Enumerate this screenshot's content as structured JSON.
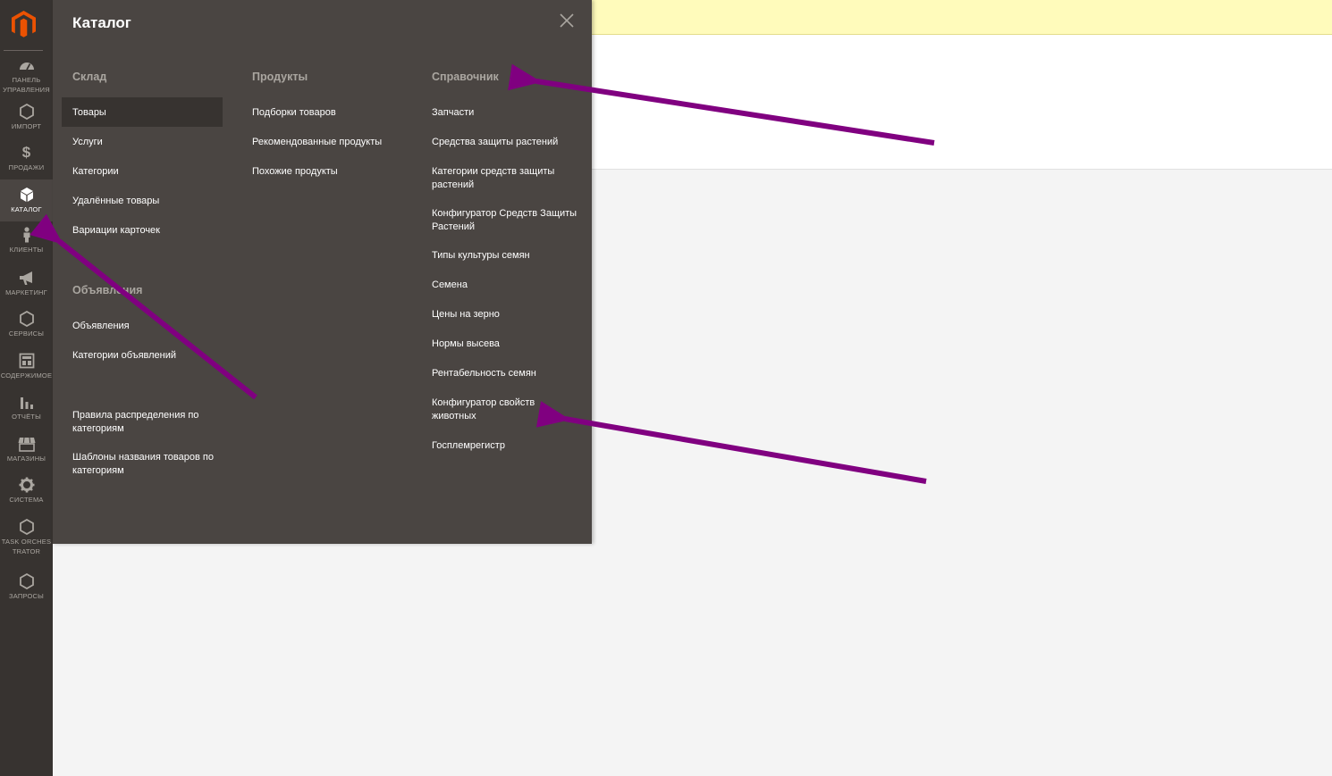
{
  "nav": {
    "items": [
      {
        "label": "ПАНЕЛЬ УПРАВЛЕНИЯ",
        "icon": "dashboard-icon"
      },
      {
        "label": "ИМПОРТ",
        "icon": "hexagon-icon"
      },
      {
        "label": "ПРОДАЖИ",
        "icon": "dollar-icon"
      },
      {
        "label": "КАТАЛОГ",
        "icon": "box-icon"
      },
      {
        "label": "КЛИЕНТЫ",
        "icon": "person-icon"
      },
      {
        "label": "МАРКЕТИНГ",
        "icon": "megaphone-icon"
      },
      {
        "label": "СЕРВИСЫ",
        "icon": "hexagon-icon"
      },
      {
        "label": "СОДЕРЖИМОЕ",
        "icon": "layout-icon"
      },
      {
        "label": "ОТЧЁТЫ",
        "icon": "bar-chart-icon"
      },
      {
        "label": "МАГАЗИНЫ",
        "icon": "store-icon"
      },
      {
        "label": "СИСТЕМА",
        "icon": "gear-icon"
      },
      {
        "label": "TASK ORCHESTRATOR",
        "icon": "hexagon-icon"
      },
      {
        "label": "ЗАПРОСЫ",
        "icon": "hexagon-icon"
      }
    ]
  },
  "flyout": {
    "title": "Каталог",
    "sklad": {
      "title": "Склад",
      "items": [
        "Товары",
        "Услуги",
        "Категории",
        "Удалённые товары",
        "Вариации карточек"
      ]
    },
    "produkty": {
      "title": "Продукты",
      "items": [
        "Подборки товаров",
        "Рекомендованные продукты",
        "Похожие продукты"
      ]
    },
    "spravochnik": {
      "title": "Справочник",
      "items": [
        "Запчасти",
        "Средства защиты растений",
        "Категории средств защиты растений",
        "Конфигуратор Средств Защиты Растений",
        "Типы культуры семян",
        "Семена",
        "Цены на зерно",
        "Нормы высева",
        "Рентабельность семян",
        "Конфигуратор свойств животных",
        "Госплемрегистр"
      ]
    },
    "obyavleniya": {
      "title": "Объявления",
      "items": [
        "Объявления",
        "Категории объявлений"
      ]
    },
    "extra": {
      "items": [
        "Правила распределения по категориям",
        "Шаблоны названия товаров по категориям"
      ]
    }
  },
  "colors": {
    "sidebar": "#373330",
    "flyout": "#4a4542",
    "accent": "#eb5202",
    "annotation_arrow": "#800080",
    "notice": "#fffbbb"
  }
}
